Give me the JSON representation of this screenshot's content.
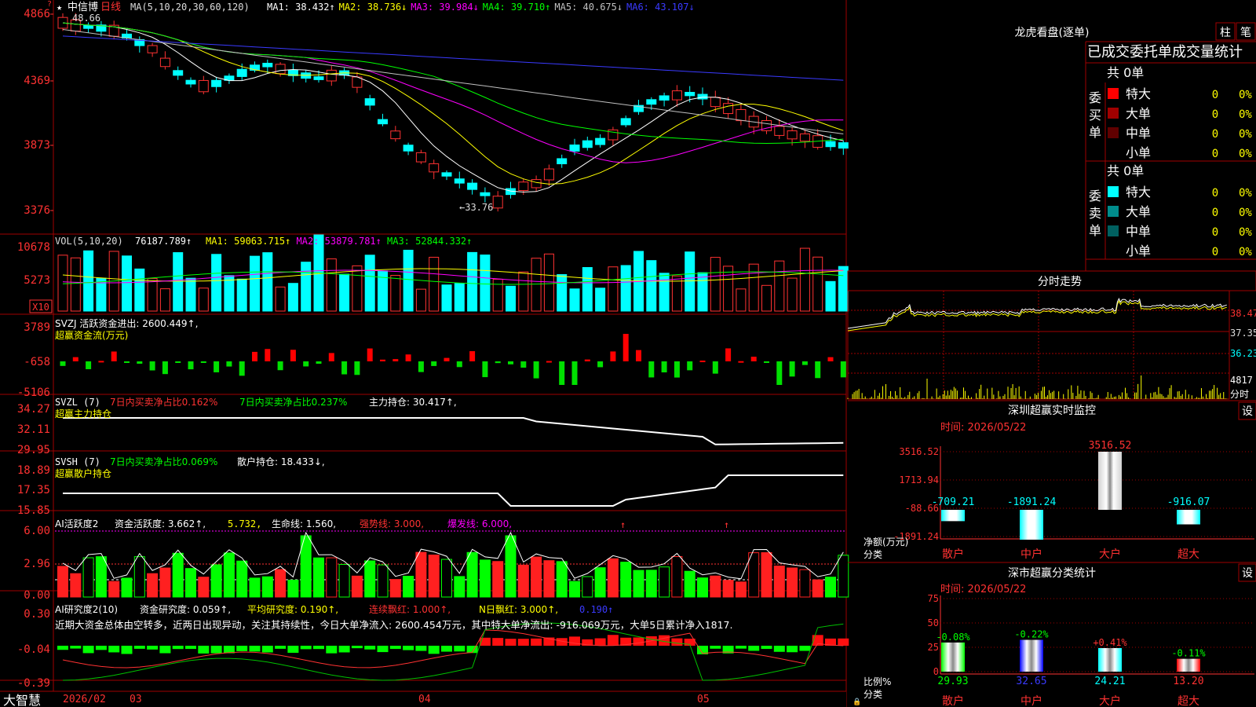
{
  "stock": {
    "star": "★",
    "name": "中信博",
    "period": "日线",
    "ma_label": "MA(5,10,20,30,60,120)",
    "high_label": "48.66",
    "low_label": "←33.76"
  },
  "price_ma": [
    {
      "label": "MA1: 38.432↑",
      "color": "#ffffff"
    },
    {
      "label": "MA2: 38.736↓",
      "color": "#ffff00"
    },
    {
      "label": "MA3: 39.984↓",
      "color": "#ff00ff"
    },
    {
      "label": "MA4: 39.710↑",
      "color": "#00ff00"
    },
    {
      "label": "MA5: 40.675↓",
      "color": "#c0c0c0"
    },
    {
      "label": "MA6: 43.107↓",
      "color": "#3a3aff"
    }
  ],
  "price_axis": [
    "4866",
    "4369",
    "3873",
    "3376"
  ],
  "vol": {
    "title": "VOL(5,10,20)",
    "value": "76187.789↑",
    "ma": [
      {
        "label": "MA1: 59063.715↑",
        "color": "#ffff00"
      },
      {
        "label": "MA2: 53879.781↑",
        "color": "#ff00ff"
      },
      {
        "label": "MA3: 52844.332↑",
        "color": "#00ff00"
      }
    ],
    "axis": [
      "10678",
      "5273"
    ],
    "unit": "X10"
  },
  "svzj": {
    "line1": "SVZJ  活跃资金进出: 2600.449↑,",
    "line2": "超赢资金流(万元)",
    "axis": [
      "3789",
      "-658",
      "-5106"
    ]
  },
  "svzl": {
    "title": "SVZL (7)",
    "p1": "7日内买卖净占比0.162%",
    "p2": "7日内买卖净占比0.237%",
    "p3": "主力持仓: 30.417↑,",
    "line2": "超赢主力持仓",
    "axis": [
      "34.27",
      "32.11",
      "29.95"
    ]
  },
  "svsh": {
    "title": "SVSH (7)",
    "p1": "7日内买卖净占比0.069%",
    "p2": "散户持仓: 18.433↓,",
    "line2": "超赢散户持仓",
    "axis": [
      "18.89",
      "17.35",
      "15.85"
    ]
  },
  "ai1": {
    "title": "AI活跃度2",
    "a": "资金活跃度: 3.662↑,",
    "b": "5.732,",
    "c": "生命线: 1.560,",
    "d": "强势线: 3.000,",
    "e": "爆发线: 6.000,",
    "axis": [
      "6.00",
      "2.96",
      "0.00"
    ]
  },
  "ai2": {
    "title": "AI研究度2(10)",
    "a": "资金研究度: 0.059↑,",
    "b": "平均研究度: 0.190↑,",
    "c": "连续飘红: 1.000↑,",
    "d": "N日飘红: 3.000↑,",
    "e": "0.190↑",
    "note": "近期大资金总体由空转多，近两日出现异动，关注其持续性，今日大单净流入: 2600.454万元，其中特大单净流出: -916.069万元，大单5日累计净入1817.",
    "axis": [
      "0.30",
      "-0.04",
      "-0.39"
    ]
  },
  "bottom": {
    "brand": "大智慧",
    "date": "2026/02",
    "m3": "03",
    "m4": "04",
    "m5": "05"
  },
  "right": {
    "lhb_title": "龙虎看盘(逐单)",
    "btn1": "柱",
    "btn2": "笔",
    "sub_title": "已成交委托单成交量统计",
    "buy": {
      "label": "委买单",
      "total": "共 0单",
      "rows": [
        {
          "name": "特大",
          "n": "0",
          "p": "0%",
          "color": "#ff0000"
        },
        {
          "name": "大单",
          "n": "0",
          "p": "0%",
          "color": "#a00000"
        },
        {
          "name": "中单",
          "n": "0",
          "p": "0%",
          "color": "#600000"
        },
        {
          "name": "小单",
          "n": "0",
          "p": "0%",
          "color": "#000000"
        }
      ]
    },
    "sell": {
      "label": "委卖单",
      "total": "共 0单",
      "rows": [
        {
          "name": "特大",
          "n": "0",
          "p": "0%",
          "color": "#00ffff"
        },
        {
          "name": "大单",
          "n": "0",
          "p": "0%",
          "color": "#008c8c"
        },
        {
          "name": "中单",
          "n": "0",
          "p": "0%",
          "color": "#006060"
        },
        {
          "name": "小单",
          "n": "0",
          "p": "0%",
          "color": "#000000"
        }
      ]
    },
    "fs_title": "分时走势",
    "fs_axis": [
      "38.47",
      "37.35",
      "36.23",
      "4817",
      "分时"
    ],
    "sz_title": "深圳超赢实时监控",
    "sz_btn": "设",
    "sz_time": "时间: 2026/05/22",
    "sz_axis": [
      "3516.52",
      "1713.94",
      "-88.66",
      "-1891.24"
    ],
    "sz_bars": [
      {
        "v": -709.21,
        "label": "-709.21"
      },
      {
        "v": -1891.24,
        "label": "-1891.24"
      },
      {
        "v": 3516.52,
        "label": "3516.52"
      },
      {
        "v": -916.07,
        "label": "-916.07"
      }
    ],
    "sz_ylabel": "净额(万元)",
    "sz_xlabel": "分类",
    "cats": [
      "散户",
      "中户",
      "大户",
      "超大"
    ],
    "sc_title": "深市超赢分类统计",
    "sc_btn": "设",
    "sc_time": "时间: 2026/05/22",
    "sc_axis": [
      "75",
      "50",
      "25",
      "0"
    ],
    "sc_bars": [
      {
        "v": 29.93,
        "label": "29.93",
        "chg": "-0.08%"
      },
      {
        "v": 32.65,
        "label": "32.65",
        "chg": "-0.22%"
      },
      {
        "v": 24.21,
        "label": "24.21",
        "chg": "+0.41%"
      },
      {
        "v": 13.2,
        "label": "13.20",
        "chg": "-0.11%"
      }
    ],
    "sc_ylabel": "比例%",
    "sc_xlabel": "分类"
  }
}
